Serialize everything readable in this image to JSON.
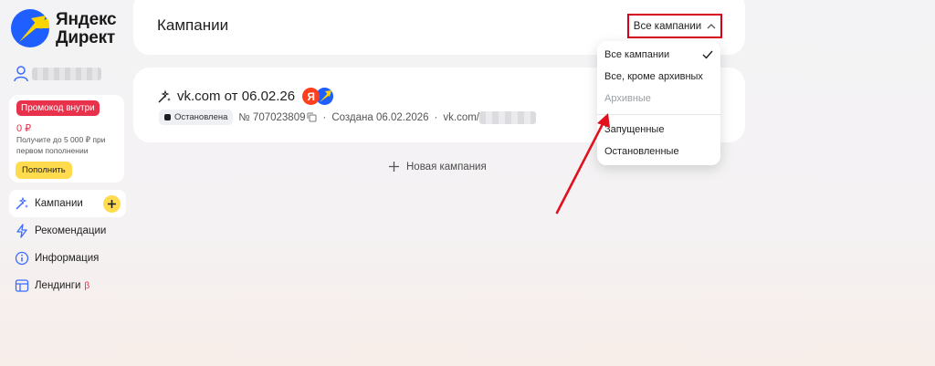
{
  "brand": {
    "logo_line1": "Яндекс",
    "logo_line2": "Директ",
    "accent": "#ffdb4d",
    "red": "#e8314b"
  },
  "sidebar": {
    "promo": {
      "badge": "Промокод внутри",
      "amount": "0 ₽",
      "description": "Получите до 5 000 ₽ при первом пополнении",
      "button": "Пополнить"
    },
    "nav": [
      {
        "label": "Кампании",
        "icon": "magic-wand-icon",
        "active": true
      },
      {
        "label": "Рекомендации",
        "icon": "lightning-icon"
      },
      {
        "label": "Информация",
        "icon": "info-icon"
      },
      {
        "label": "Лендинги",
        "icon": "landing-icon",
        "badge": "β"
      }
    ]
  },
  "header": {
    "title": "Кампании",
    "filter_label": "Все кампании"
  },
  "campaign": {
    "title": "vk.com от 06.02.26",
    "ya_badge": "Я",
    "status": "Остановлена",
    "number": "№ 707023809",
    "created": "Создана 06.02.2026",
    "url_prefix": "vk.com/"
  },
  "new_campaign_label": "Новая кампания",
  "dropdown": {
    "items_top": [
      {
        "label": "Все кампании",
        "checked": true
      },
      {
        "label": "Все, кроме архивных"
      },
      {
        "label": "Архивные",
        "disabled": true
      }
    ],
    "items_bottom": [
      {
        "label": "Запущенные"
      },
      {
        "label": "Остановленные"
      }
    ]
  }
}
